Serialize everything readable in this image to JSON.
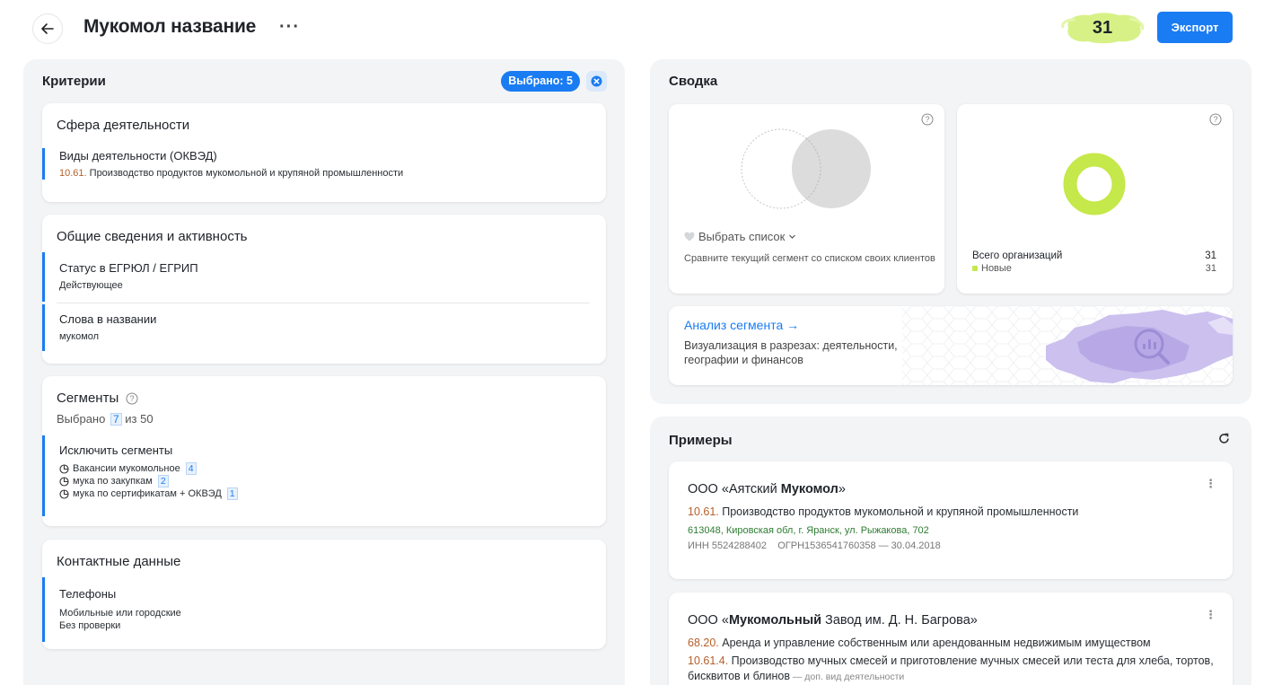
{
  "header": {
    "title": "Мукомол название",
    "more_label": "···",
    "count": "31",
    "export_label": "Экспорт",
    "count_blob_color": "#d4f07a"
  },
  "criteria": {
    "title": "Критерии",
    "selected_badge": "Выбрано: 5",
    "sections": {
      "activity": {
        "title": "Сфера деятельности",
        "okved_title": "Виды деятельности (ОКВЭД)",
        "okved_code": "10.61.",
        "okved_text": "Производство продуктов мукомольной и крупяной промышленности"
      },
      "general": {
        "title": "Общие сведения и активность",
        "status_title": "Статус в ЕГРЮЛ / ЕГРИП",
        "status_value": "Действующее",
        "words_title": "Слова в названии",
        "words_value": "мукомол"
      },
      "segments": {
        "title": "Сегменты",
        "selected_prefix": "Выбрано",
        "selected_count": "7",
        "selected_suffix": "из 50",
        "exclude_title": "Исключить сегменты",
        "items": [
          {
            "label": "Вакансии мукомольное",
            "count": "4"
          },
          {
            "label": "мука по закупкам",
            "count": "2"
          },
          {
            "label": "мука по сертификатам + ОКВЭД",
            "count": "1"
          }
        ]
      },
      "contacts": {
        "title": "Контактные данные",
        "phones_title": "Телефоны",
        "phones_line1": "Мобильные или городские",
        "phones_line2": "Без проверки"
      }
    }
  },
  "summary": {
    "title": "Сводка",
    "compare": {
      "choose_label": "Выбрать список",
      "description": "Сравните текущий сегмент со списком своих клиентов"
    },
    "totals": {
      "total_label": "Всего организаций",
      "total_value": "31",
      "new_label": "Новые",
      "new_value": "31",
      "donut_color": "#c5e84a"
    },
    "analysis": {
      "title": "Анализ сегмента →",
      "description": "Визуализация в разрезах: деятельности, географии и финансов"
    }
  },
  "examples": {
    "title": "Примеры",
    "items": [
      {
        "name_prefix": "ООО «Аятский ",
        "name_bold": "Мукомол",
        "name_suffix": "»",
        "okved_code": "10.61.",
        "okved_text": " Производство продуктов мукомольной и крупяной промышленности",
        "address": "613048, Кировская обл, г. Яранск, ул. Рыжакова, 702",
        "ids": "ИНН 5524288402    ОГРН1536541760358 — 30.04.2018"
      },
      {
        "name_prefix": "ООО «",
        "name_bold": "Мукомольный",
        "name_suffix": " Завод им. Д. Н. Багрова»",
        "okved_code": "68.20.",
        "okved_text": " Аренда и управление собственным или арендованным недвижимым имуществом",
        "okved2_code": "10.61.4.",
        "okved2_text": " Производство мучных смесей и приготовление мучных смесей или теста для хлеба, тортов, бисквитов и блинов",
        "okved2_note": " — доп. вид деятельности"
      }
    ]
  }
}
